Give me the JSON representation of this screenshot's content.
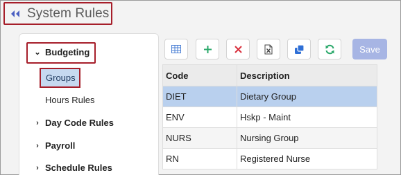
{
  "header": {
    "title": "System Rules",
    "back_icon": "double-chevron-left-icon"
  },
  "sidebar": {
    "items": [
      {
        "label": "Budgeting",
        "expanded": true
      },
      {
        "label": "Groups",
        "selected": true
      },
      {
        "label": "Hours Rules"
      },
      {
        "label": "Day Code Rules"
      },
      {
        "label": "Payroll"
      },
      {
        "label": "Schedule Rules"
      }
    ]
  },
  "toolbar": {
    "buttons": [
      {
        "name": "grid-view-icon",
        "color": "#4a7fd4"
      },
      {
        "name": "add-icon",
        "color": "#2aa86a"
      },
      {
        "name": "delete-icon",
        "color": "#d9303d"
      },
      {
        "name": "excel-export-icon",
        "color": "#444444"
      },
      {
        "name": "copy-icon",
        "color": "#2f6fd6"
      },
      {
        "name": "refresh-icon",
        "color": "#2aa86a"
      }
    ],
    "save_label": "Save"
  },
  "table": {
    "columns": [
      "Code",
      "Description"
    ],
    "rows": [
      {
        "code": "DIET",
        "description": "Dietary Group"
      },
      {
        "code": "ENV",
        "description": "Hskp - Maint"
      },
      {
        "code": "NURS",
        "description": "Nursing Group"
      },
      {
        "code": "RN",
        "description": "Registered Nurse"
      }
    ]
  },
  "colors": {
    "accent_border": "#a61e2a",
    "selected_row": "#b9d0ee",
    "save_button": "#a7b5e4"
  }
}
